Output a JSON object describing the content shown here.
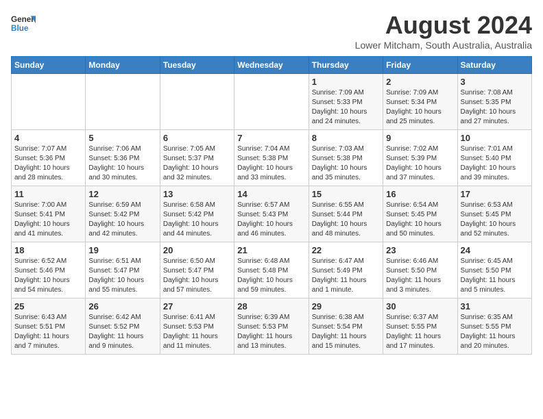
{
  "header": {
    "logo_line1": "General",
    "logo_line2": "Blue",
    "month_year": "August 2024",
    "location": "Lower Mitcham, South Australia, Australia"
  },
  "days_of_week": [
    "Sunday",
    "Monday",
    "Tuesday",
    "Wednesday",
    "Thursday",
    "Friday",
    "Saturday"
  ],
  "weeks": [
    [
      {
        "day": "",
        "info": ""
      },
      {
        "day": "",
        "info": ""
      },
      {
        "day": "",
        "info": ""
      },
      {
        "day": "",
        "info": ""
      },
      {
        "day": "1",
        "info": "Sunrise: 7:09 AM\nSunset: 5:33 PM\nDaylight: 10 hours\nand 24 minutes."
      },
      {
        "day": "2",
        "info": "Sunrise: 7:09 AM\nSunset: 5:34 PM\nDaylight: 10 hours\nand 25 minutes."
      },
      {
        "day": "3",
        "info": "Sunrise: 7:08 AM\nSunset: 5:35 PM\nDaylight: 10 hours\nand 27 minutes."
      }
    ],
    [
      {
        "day": "4",
        "info": "Sunrise: 7:07 AM\nSunset: 5:36 PM\nDaylight: 10 hours\nand 28 minutes."
      },
      {
        "day": "5",
        "info": "Sunrise: 7:06 AM\nSunset: 5:36 PM\nDaylight: 10 hours\nand 30 minutes."
      },
      {
        "day": "6",
        "info": "Sunrise: 7:05 AM\nSunset: 5:37 PM\nDaylight: 10 hours\nand 32 minutes."
      },
      {
        "day": "7",
        "info": "Sunrise: 7:04 AM\nSunset: 5:38 PM\nDaylight: 10 hours\nand 33 minutes."
      },
      {
        "day": "8",
        "info": "Sunrise: 7:03 AM\nSunset: 5:38 PM\nDaylight: 10 hours\nand 35 minutes."
      },
      {
        "day": "9",
        "info": "Sunrise: 7:02 AM\nSunset: 5:39 PM\nDaylight: 10 hours\nand 37 minutes."
      },
      {
        "day": "10",
        "info": "Sunrise: 7:01 AM\nSunset: 5:40 PM\nDaylight: 10 hours\nand 39 minutes."
      }
    ],
    [
      {
        "day": "11",
        "info": "Sunrise: 7:00 AM\nSunset: 5:41 PM\nDaylight: 10 hours\nand 41 minutes."
      },
      {
        "day": "12",
        "info": "Sunrise: 6:59 AM\nSunset: 5:42 PM\nDaylight: 10 hours\nand 42 minutes."
      },
      {
        "day": "13",
        "info": "Sunrise: 6:58 AM\nSunset: 5:42 PM\nDaylight: 10 hours\nand 44 minutes."
      },
      {
        "day": "14",
        "info": "Sunrise: 6:57 AM\nSunset: 5:43 PM\nDaylight: 10 hours\nand 46 minutes."
      },
      {
        "day": "15",
        "info": "Sunrise: 6:55 AM\nSunset: 5:44 PM\nDaylight: 10 hours\nand 48 minutes."
      },
      {
        "day": "16",
        "info": "Sunrise: 6:54 AM\nSunset: 5:45 PM\nDaylight: 10 hours\nand 50 minutes."
      },
      {
        "day": "17",
        "info": "Sunrise: 6:53 AM\nSunset: 5:45 PM\nDaylight: 10 hours\nand 52 minutes."
      }
    ],
    [
      {
        "day": "18",
        "info": "Sunrise: 6:52 AM\nSunset: 5:46 PM\nDaylight: 10 hours\nand 54 minutes."
      },
      {
        "day": "19",
        "info": "Sunrise: 6:51 AM\nSunset: 5:47 PM\nDaylight: 10 hours\nand 55 minutes."
      },
      {
        "day": "20",
        "info": "Sunrise: 6:50 AM\nSunset: 5:47 PM\nDaylight: 10 hours\nand 57 minutes."
      },
      {
        "day": "21",
        "info": "Sunrise: 6:48 AM\nSunset: 5:48 PM\nDaylight: 10 hours\nand 59 minutes."
      },
      {
        "day": "22",
        "info": "Sunrise: 6:47 AM\nSunset: 5:49 PM\nDaylight: 11 hours\nand 1 minute."
      },
      {
        "day": "23",
        "info": "Sunrise: 6:46 AM\nSunset: 5:50 PM\nDaylight: 11 hours\nand 3 minutes."
      },
      {
        "day": "24",
        "info": "Sunrise: 6:45 AM\nSunset: 5:50 PM\nDaylight: 11 hours\nand 5 minutes."
      }
    ],
    [
      {
        "day": "25",
        "info": "Sunrise: 6:43 AM\nSunset: 5:51 PM\nDaylight: 11 hours\nand 7 minutes."
      },
      {
        "day": "26",
        "info": "Sunrise: 6:42 AM\nSunset: 5:52 PM\nDaylight: 11 hours\nand 9 minutes."
      },
      {
        "day": "27",
        "info": "Sunrise: 6:41 AM\nSunset: 5:53 PM\nDaylight: 11 hours\nand 11 minutes."
      },
      {
        "day": "28",
        "info": "Sunrise: 6:39 AM\nSunset: 5:53 PM\nDaylight: 11 hours\nand 13 minutes."
      },
      {
        "day": "29",
        "info": "Sunrise: 6:38 AM\nSunset: 5:54 PM\nDaylight: 11 hours\nand 15 minutes."
      },
      {
        "day": "30",
        "info": "Sunrise: 6:37 AM\nSunset: 5:55 PM\nDaylight: 11 hours\nand 17 minutes."
      },
      {
        "day": "31",
        "info": "Sunrise: 6:35 AM\nSunset: 5:55 PM\nDaylight: 11 hours\nand 20 minutes."
      }
    ]
  ]
}
